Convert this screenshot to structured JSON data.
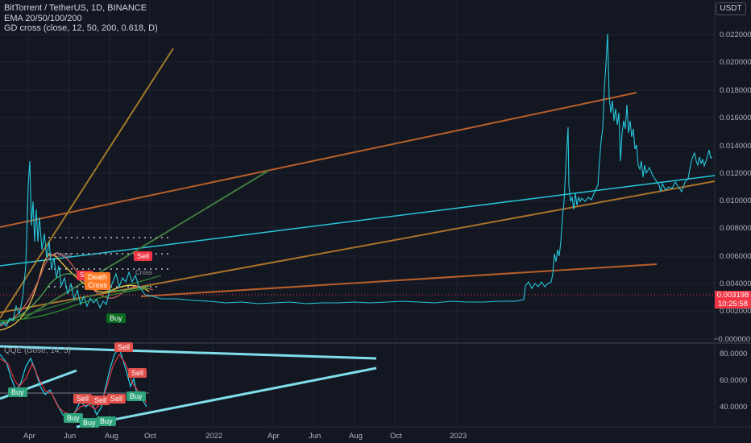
{
  "legend": {
    "title": "BitTorrent / TetherUS, 1D, BINANCE",
    "ema": "EMA 20/50/100/200",
    "gdcross": "GD cross (close, 12, 50, 200, 0.618, D)"
  },
  "qqe_legend": "QQE (close, 14, 5)",
  "currency": "USDT",
  "price_axis": [
    "0.022000",
    "0.020000",
    "0.018000",
    "0.016000",
    "0.014000",
    "0.012000",
    "0.010000",
    "0.008000",
    "0.006000",
    "0.004000",
    "0.002000",
    "−0.000000"
  ],
  "qqe_axis": [
    "80.0000",
    "60.0000",
    "40.0000"
  ],
  "last_price": "0.003198",
  "countdown": "10:25:58",
  "time_axis": [
    "Apr",
    "Jun",
    "Aug",
    "Oct",
    "2022",
    "Apr",
    "Jun",
    "Aug",
    "Oct",
    "2023"
  ],
  "signals": {
    "sell_main": "Sell",
    "death": "Death\nCross",
    "buy_main": "Buy",
    "qqe_sell": "Sell",
    "qqe_buy": "Buy",
    "cross_label": "Cross"
  },
  "colors": {
    "bg": "#131722",
    "price": "#26c6da",
    "sell": "#f23645",
    "buy": "#089981"
  }
}
